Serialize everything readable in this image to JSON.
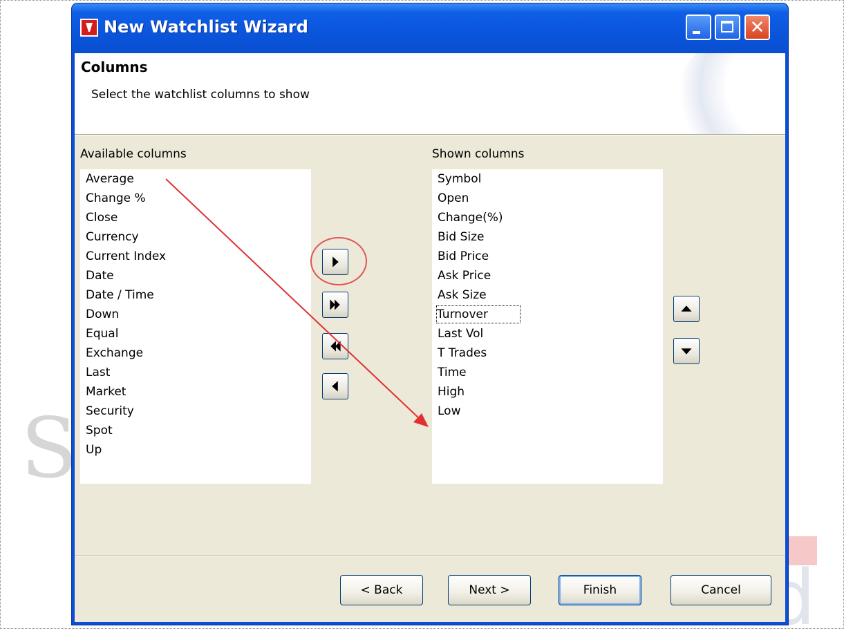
{
  "window": {
    "title": "New Watchlist Wizard"
  },
  "header": {
    "title": "Columns",
    "subtitle": "Select the watchlist columns to show"
  },
  "available": {
    "label": "Available columns",
    "items": [
      "Average",
      "Change %",
      "Close",
      "Currency",
      "Current Index",
      "Date",
      "Date / Time",
      "Down",
      "Equal",
      "Exchange",
      "Last",
      "Market",
      "Security",
      "Spot",
      "Up"
    ]
  },
  "shown": {
    "label": "Shown columns",
    "items": [
      "Symbol",
      "Open",
      "Change(%)",
      "Bid Size",
      "Bid Price",
      "Ask Price",
      "Ask Size",
      "Turnover",
      "Last Vol",
      "T Trades",
      "Time",
      "High",
      "Low"
    ],
    "focused_item": "Turnover"
  },
  "buttons": {
    "back": "< Back",
    "next": "Next >",
    "finish": "Finish",
    "cancel": "Cancel"
  },
  "icons": {
    "add": "triangle-right-icon",
    "add_all": "double-triangle-right-icon",
    "remove_all": "double-triangle-left-icon",
    "remove": "triangle-left-icon",
    "move_up": "triangle-up-icon",
    "move_down": "triangle-down-icon"
  },
  "colors": {
    "titlebar": "#0a55dc",
    "client_bg": "#ece9d8",
    "annotation_red": "#e05454"
  },
  "watermark": {
    "left_text": "S",
    "right_text": "d"
  }
}
